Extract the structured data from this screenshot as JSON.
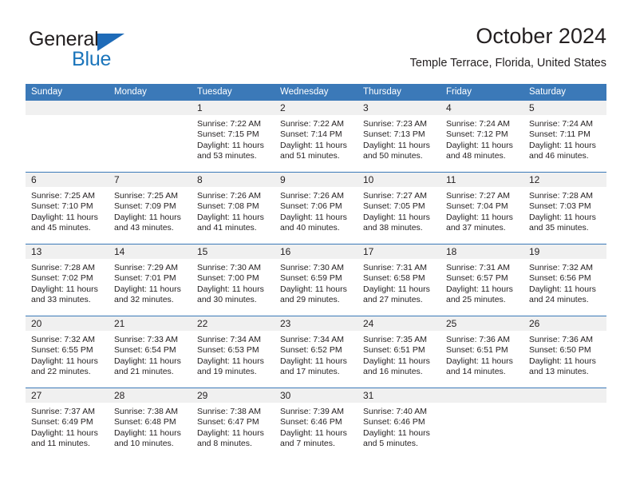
{
  "brand": {
    "name_top": "General",
    "name_bottom": "Blue",
    "color_dark": "#231f20",
    "color_blue": "#1b75bb",
    "triangle_icon": "triangle-logo-icon"
  },
  "header": {
    "title": "October 2024",
    "subtitle": "Temple Terrace, Florida, United States"
  },
  "theme": {
    "header_blue": "#3b79b8",
    "day_band_gray": "#f0f0f0",
    "text": "#231f20"
  },
  "weekdays": [
    "Sunday",
    "Monday",
    "Tuesday",
    "Wednesday",
    "Thursday",
    "Friday",
    "Saturday"
  ],
  "weeks": [
    [
      {
        "day": "",
        "sunrise": "",
        "sunset": "",
        "daylight1": "",
        "daylight2": ""
      },
      {
        "day": "",
        "sunrise": "",
        "sunset": "",
        "daylight1": "",
        "daylight2": ""
      },
      {
        "day": "1",
        "sunrise": "Sunrise: 7:22 AM",
        "sunset": "Sunset: 7:15 PM",
        "daylight1": "Daylight: 11 hours",
        "daylight2": "and 53 minutes."
      },
      {
        "day": "2",
        "sunrise": "Sunrise: 7:22 AM",
        "sunset": "Sunset: 7:14 PM",
        "daylight1": "Daylight: 11 hours",
        "daylight2": "and 51 minutes."
      },
      {
        "day": "3",
        "sunrise": "Sunrise: 7:23 AM",
        "sunset": "Sunset: 7:13 PM",
        "daylight1": "Daylight: 11 hours",
        "daylight2": "and 50 minutes."
      },
      {
        "day": "4",
        "sunrise": "Sunrise: 7:24 AM",
        "sunset": "Sunset: 7:12 PM",
        "daylight1": "Daylight: 11 hours",
        "daylight2": "and 48 minutes."
      },
      {
        "day": "5",
        "sunrise": "Sunrise: 7:24 AM",
        "sunset": "Sunset: 7:11 PM",
        "daylight1": "Daylight: 11 hours",
        "daylight2": "and 46 minutes."
      }
    ],
    [
      {
        "day": "6",
        "sunrise": "Sunrise: 7:25 AM",
        "sunset": "Sunset: 7:10 PM",
        "daylight1": "Daylight: 11 hours",
        "daylight2": "and 45 minutes."
      },
      {
        "day": "7",
        "sunrise": "Sunrise: 7:25 AM",
        "sunset": "Sunset: 7:09 PM",
        "daylight1": "Daylight: 11 hours",
        "daylight2": "and 43 minutes."
      },
      {
        "day": "8",
        "sunrise": "Sunrise: 7:26 AM",
        "sunset": "Sunset: 7:08 PM",
        "daylight1": "Daylight: 11 hours",
        "daylight2": "and 41 minutes."
      },
      {
        "day": "9",
        "sunrise": "Sunrise: 7:26 AM",
        "sunset": "Sunset: 7:06 PM",
        "daylight1": "Daylight: 11 hours",
        "daylight2": "and 40 minutes."
      },
      {
        "day": "10",
        "sunrise": "Sunrise: 7:27 AM",
        "sunset": "Sunset: 7:05 PM",
        "daylight1": "Daylight: 11 hours",
        "daylight2": "and 38 minutes."
      },
      {
        "day": "11",
        "sunrise": "Sunrise: 7:27 AM",
        "sunset": "Sunset: 7:04 PM",
        "daylight1": "Daylight: 11 hours",
        "daylight2": "and 37 minutes."
      },
      {
        "day": "12",
        "sunrise": "Sunrise: 7:28 AM",
        "sunset": "Sunset: 7:03 PM",
        "daylight1": "Daylight: 11 hours",
        "daylight2": "and 35 minutes."
      }
    ],
    [
      {
        "day": "13",
        "sunrise": "Sunrise: 7:28 AM",
        "sunset": "Sunset: 7:02 PM",
        "daylight1": "Daylight: 11 hours",
        "daylight2": "and 33 minutes."
      },
      {
        "day": "14",
        "sunrise": "Sunrise: 7:29 AM",
        "sunset": "Sunset: 7:01 PM",
        "daylight1": "Daylight: 11 hours",
        "daylight2": "and 32 minutes."
      },
      {
        "day": "15",
        "sunrise": "Sunrise: 7:30 AM",
        "sunset": "Sunset: 7:00 PM",
        "daylight1": "Daylight: 11 hours",
        "daylight2": "and 30 minutes."
      },
      {
        "day": "16",
        "sunrise": "Sunrise: 7:30 AM",
        "sunset": "Sunset: 6:59 PM",
        "daylight1": "Daylight: 11 hours",
        "daylight2": "and 29 minutes."
      },
      {
        "day": "17",
        "sunrise": "Sunrise: 7:31 AM",
        "sunset": "Sunset: 6:58 PM",
        "daylight1": "Daylight: 11 hours",
        "daylight2": "and 27 minutes."
      },
      {
        "day": "18",
        "sunrise": "Sunrise: 7:31 AM",
        "sunset": "Sunset: 6:57 PM",
        "daylight1": "Daylight: 11 hours",
        "daylight2": "and 25 minutes."
      },
      {
        "day": "19",
        "sunrise": "Sunrise: 7:32 AM",
        "sunset": "Sunset: 6:56 PM",
        "daylight1": "Daylight: 11 hours",
        "daylight2": "and 24 minutes."
      }
    ],
    [
      {
        "day": "20",
        "sunrise": "Sunrise: 7:32 AM",
        "sunset": "Sunset: 6:55 PM",
        "daylight1": "Daylight: 11 hours",
        "daylight2": "and 22 minutes."
      },
      {
        "day": "21",
        "sunrise": "Sunrise: 7:33 AM",
        "sunset": "Sunset: 6:54 PM",
        "daylight1": "Daylight: 11 hours",
        "daylight2": "and 21 minutes."
      },
      {
        "day": "22",
        "sunrise": "Sunrise: 7:34 AM",
        "sunset": "Sunset: 6:53 PM",
        "daylight1": "Daylight: 11 hours",
        "daylight2": "and 19 minutes."
      },
      {
        "day": "23",
        "sunrise": "Sunrise: 7:34 AM",
        "sunset": "Sunset: 6:52 PM",
        "daylight1": "Daylight: 11 hours",
        "daylight2": "and 17 minutes."
      },
      {
        "day": "24",
        "sunrise": "Sunrise: 7:35 AM",
        "sunset": "Sunset: 6:51 PM",
        "daylight1": "Daylight: 11 hours",
        "daylight2": "and 16 minutes."
      },
      {
        "day": "25",
        "sunrise": "Sunrise: 7:36 AM",
        "sunset": "Sunset: 6:51 PM",
        "daylight1": "Daylight: 11 hours",
        "daylight2": "and 14 minutes."
      },
      {
        "day": "26",
        "sunrise": "Sunrise: 7:36 AM",
        "sunset": "Sunset: 6:50 PM",
        "daylight1": "Daylight: 11 hours",
        "daylight2": "and 13 minutes."
      }
    ],
    [
      {
        "day": "27",
        "sunrise": "Sunrise: 7:37 AM",
        "sunset": "Sunset: 6:49 PM",
        "daylight1": "Daylight: 11 hours",
        "daylight2": "and 11 minutes."
      },
      {
        "day": "28",
        "sunrise": "Sunrise: 7:38 AM",
        "sunset": "Sunset: 6:48 PM",
        "daylight1": "Daylight: 11 hours",
        "daylight2": "and 10 minutes."
      },
      {
        "day": "29",
        "sunrise": "Sunrise: 7:38 AM",
        "sunset": "Sunset: 6:47 PM",
        "daylight1": "Daylight: 11 hours",
        "daylight2": "and 8 minutes."
      },
      {
        "day": "30",
        "sunrise": "Sunrise: 7:39 AM",
        "sunset": "Sunset: 6:46 PM",
        "daylight1": "Daylight: 11 hours",
        "daylight2": "and 7 minutes."
      },
      {
        "day": "31",
        "sunrise": "Sunrise: 7:40 AM",
        "sunset": "Sunset: 6:46 PM",
        "daylight1": "Daylight: 11 hours",
        "daylight2": "and 5 minutes."
      },
      {
        "day": "",
        "sunrise": "",
        "sunset": "",
        "daylight1": "",
        "daylight2": ""
      },
      {
        "day": "",
        "sunrise": "",
        "sunset": "",
        "daylight1": "",
        "daylight2": ""
      }
    ]
  ]
}
